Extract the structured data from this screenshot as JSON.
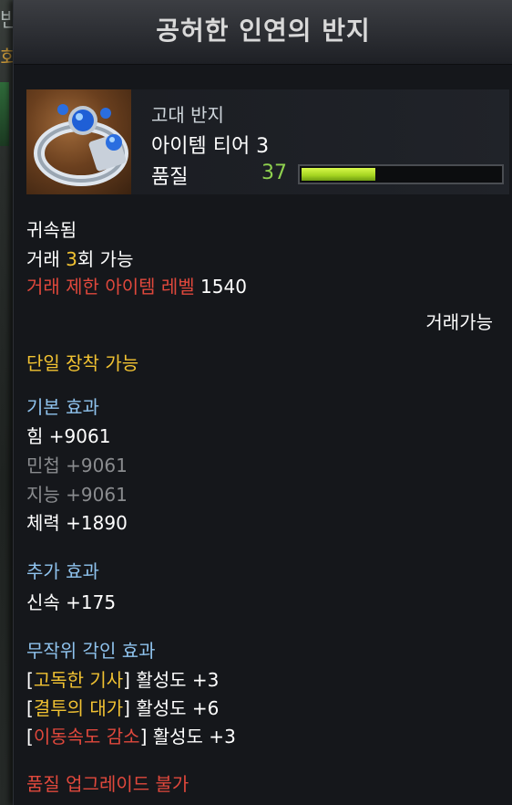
{
  "background": {
    "fragment_1": "반지",
    "fragment_2": "회 가능]"
  },
  "item": {
    "name": "공허한 인연의 반지",
    "icon": "ring-icon",
    "grade": "고대 반지",
    "tier": "아이템 티어 3",
    "quality_label": "품질",
    "quality_value": "37",
    "quality_fraction": 0.37
  },
  "binding": {
    "bound": "귀속됨",
    "trade_prefix": "거래 ",
    "trade_count": "3",
    "trade_suffix": "회 가능",
    "trade_limit_label": "거래 제한 아이템 레벨",
    "trade_limit_value": "1540",
    "tradeable": "거래가능"
  },
  "equip": {
    "single": "단일 장착 가능"
  },
  "base_effects": {
    "header": "기본 효과",
    "stats": [
      {
        "label": "힘 +9061",
        "active": true
      },
      {
        "label": "민첩 +9061",
        "active": false
      },
      {
        "label": "지능 +9061",
        "active": false
      },
      {
        "label": "체력 +1890",
        "active": true
      }
    ]
  },
  "extra_effects": {
    "header": "추가 효과",
    "stats": [
      "신속 +175"
    ]
  },
  "engravings": {
    "header": "무작위 각인 효과",
    "items": [
      {
        "open": "[",
        "name": "고독한 기사",
        "close": "]",
        "activity": " 활성도 +3",
        "penalty": false
      },
      {
        "open": "[",
        "name": "결투의 대가",
        "close": "]",
        "activity": " 활성도 +6",
        "penalty": false
      },
      {
        "open": "[",
        "name": "이동속도 감소",
        "close": "]",
        "activity": " 활성도 +3",
        "penalty": true
      }
    ]
  },
  "footer": {
    "upgrade": "품질 업그레이드 불가"
  },
  "colors": {
    "panel": "#15171b",
    "quality_green": "#8fd14f",
    "gold": "#f1c232",
    "red": "#e0483c",
    "section_blue": "#8fc3ee",
    "inactive_grey": "#8a8c8f"
  }
}
